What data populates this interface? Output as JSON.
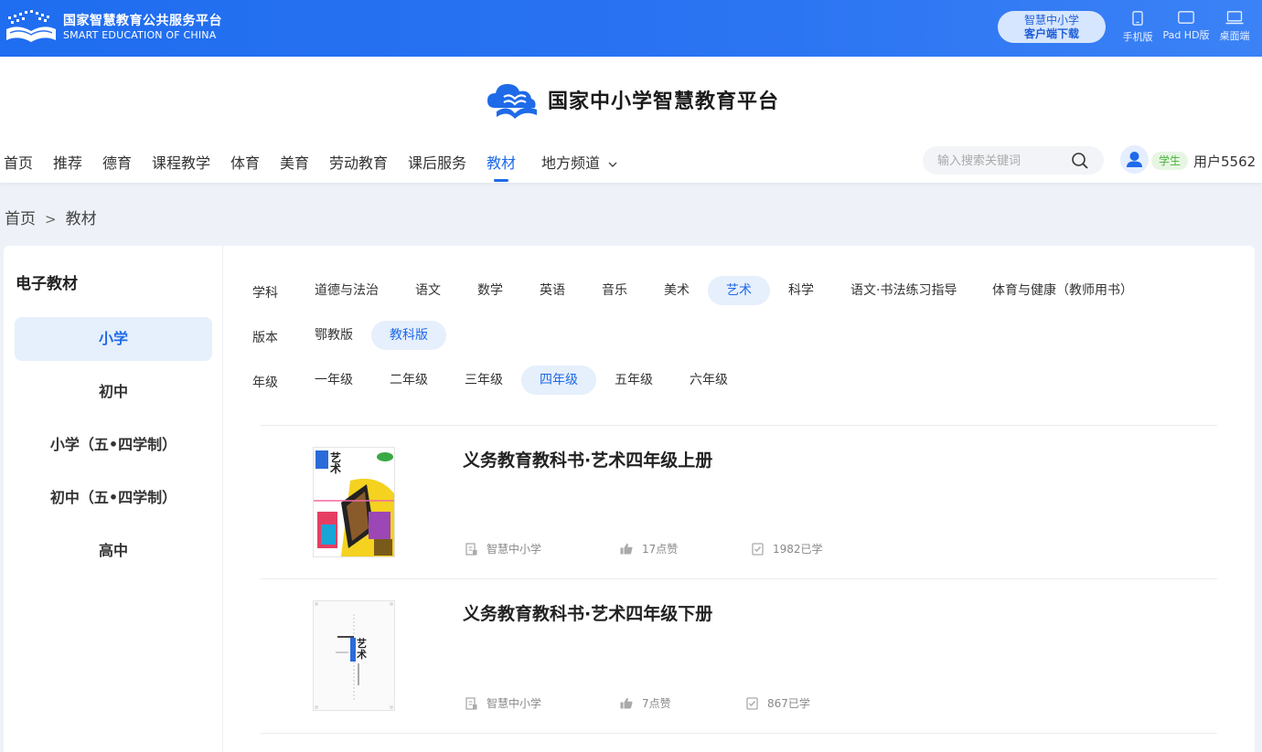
{
  "topbar": {
    "logo_cn": "国家智慧教育公共服务平台",
    "logo_en": "SMART EDUCATION OF CHINA",
    "download_line1": "智慧中小学",
    "download_line2": "客户端下载",
    "devices": [
      {
        "label": "手机版",
        "icon": "phone-icon"
      },
      {
        "label": "Pad HD版",
        "icon": "tablet-icon"
      },
      {
        "label": "桌面端",
        "icon": "laptop-icon"
      }
    ]
  },
  "header": {
    "brand": "国家中小学智慧教育平台",
    "nav": [
      "首页",
      "推荐",
      "德育",
      "课程教学",
      "体育",
      "美育",
      "劳动教育",
      "课后服务",
      "教材",
      "地方频道"
    ],
    "active_nav": "教材",
    "search_placeholder": "输入搜索关键词",
    "role_badge": "学生",
    "username": "用户5562"
  },
  "breadcrumb": {
    "home": "首页",
    "sep": ">",
    "current": "教材"
  },
  "sidebar": {
    "title": "电子教材",
    "items": [
      "小学",
      "初中",
      "小学（五•四学制）",
      "初中（五•四学制）",
      "高中"
    ],
    "active": "小学"
  },
  "filters": {
    "subject_label": "学科",
    "subjects": [
      "道德与法治",
      "语文",
      "数学",
      "英语",
      "音乐",
      "美术",
      "艺术",
      "科学",
      "语文·书法练习指导",
      "体育与健康（教师用书）"
    ],
    "active_subject": "艺术",
    "edition_label": "版本",
    "editions": [
      "鄂教版",
      "教科版"
    ],
    "active_edition": "教科版",
    "grade_label": "年级",
    "grades": [
      "一年级",
      "二年级",
      "三年级",
      "四年级",
      "五年级",
      "六年级"
    ],
    "active_grade": "四年级"
  },
  "books": [
    {
      "title": "义务教育教科书·艺术四年级上册",
      "source": "智慧中小学",
      "likes": "17点赞",
      "learners": "1982已学"
    },
    {
      "title": "义务教育教科书·艺术四年级下册",
      "source": "智慧中小学",
      "likes": "7点赞",
      "learners": "867已学"
    }
  ],
  "colors": {
    "primary": "#1e6ae8",
    "topbar": "#2b74f2",
    "active_bg": "#e6effc"
  }
}
